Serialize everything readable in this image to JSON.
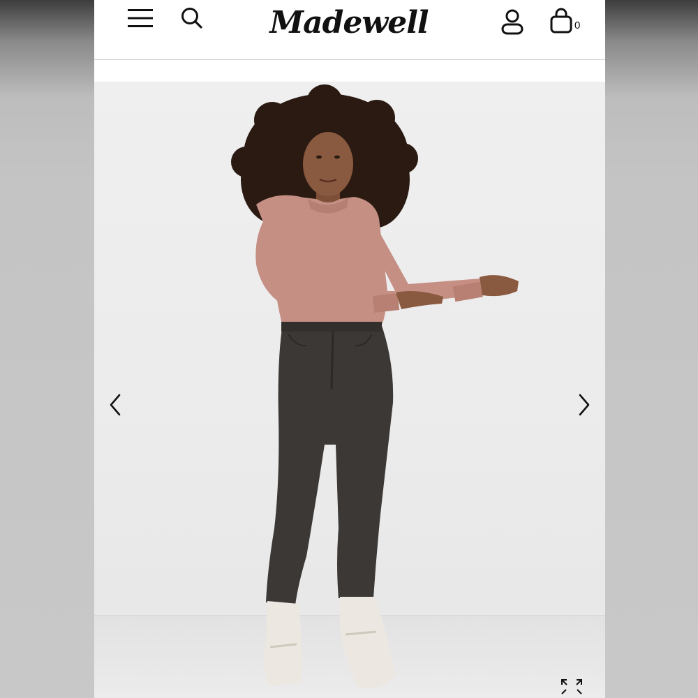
{
  "header": {
    "logo_text": "Madewell",
    "menu_icon": "hamburger-menu-icon",
    "search_icon": "search-icon",
    "account_icon": "account-icon",
    "bag_icon": "shopping-bag-icon",
    "bag_count": "0"
  },
  "gallery": {
    "image": "product-photo-model",
    "prev_icon": "chevron-left-icon",
    "next_icon": "chevron-right-icon",
    "expand_icon": "expand-icon"
  },
  "colors": {
    "sweater": "#c58f84",
    "jeans": "#3b3836",
    "hair": "#2a1a12",
    "skin": "#8a5a40",
    "sneaker": "#ece8e1",
    "backdrop": "#ececec"
  }
}
